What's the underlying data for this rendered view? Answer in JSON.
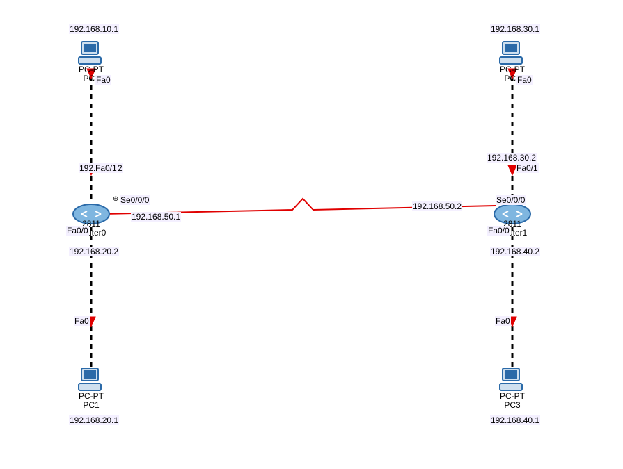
{
  "domain": "Diagram",
  "colors": {
    "link_serial": "#e00000",
    "link_eth": "#000",
    "device_blue": "#2b6aa8",
    "label_bg": "#f4f0ff"
  },
  "devices": {
    "pc0": {
      "type": "PC-PT",
      "label_line1": "PC-PT",
      "label_line2": "PC0",
      "ip": "192.168.10.1",
      "port": "Fa0"
    },
    "pc1": {
      "type": "PC-PT",
      "label_line1": "PC-PT",
      "label_line2": "PC1",
      "ip": "192.168.20.1",
      "port": "Fa0"
    },
    "pc2": {
      "type": "PC-PT",
      "label_line1": "PC-PT",
      "label_line2": "PC2",
      "ip": "192.168.30.1",
      "port": "Fa0"
    },
    "pc3": {
      "type": "PC-PT",
      "label_line1": "PC-PT",
      "label_line2": "PC3",
      "ip": "192.168.40.1",
      "port": "Fa0"
    },
    "router0": {
      "type": "2811",
      "label_line1": "2811",
      "label_line2": "Router0",
      "ports": {
        "fa00": "Fa0/0",
        "fa01": "Fa0/1",
        "se000": "Se0/0/0"
      }
    },
    "router1": {
      "type": "2811",
      "label_line1": "2811",
      "label_line2": "Router1",
      "ports": {
        "fa00": "Fa0/0",
        "fa01": "Fa0/1",
        "se000": "Se0/0/0"
      }
    }
  },
  "link_addresses": {
    "r0_fa01": "192.168.10.2",
    "frag_192": "192.",
    "frag_2": "2",
    "r0_fa00": "192.168.20.2",
    "r0_se": "192.168.50.1",
    "r1_se": "192.168.50.2",
    "r1_fa01": "192.168.30.2",
    "r1_fa00": "192.168.40.2"
  },
  "clock_symbol": "⊕"
}
